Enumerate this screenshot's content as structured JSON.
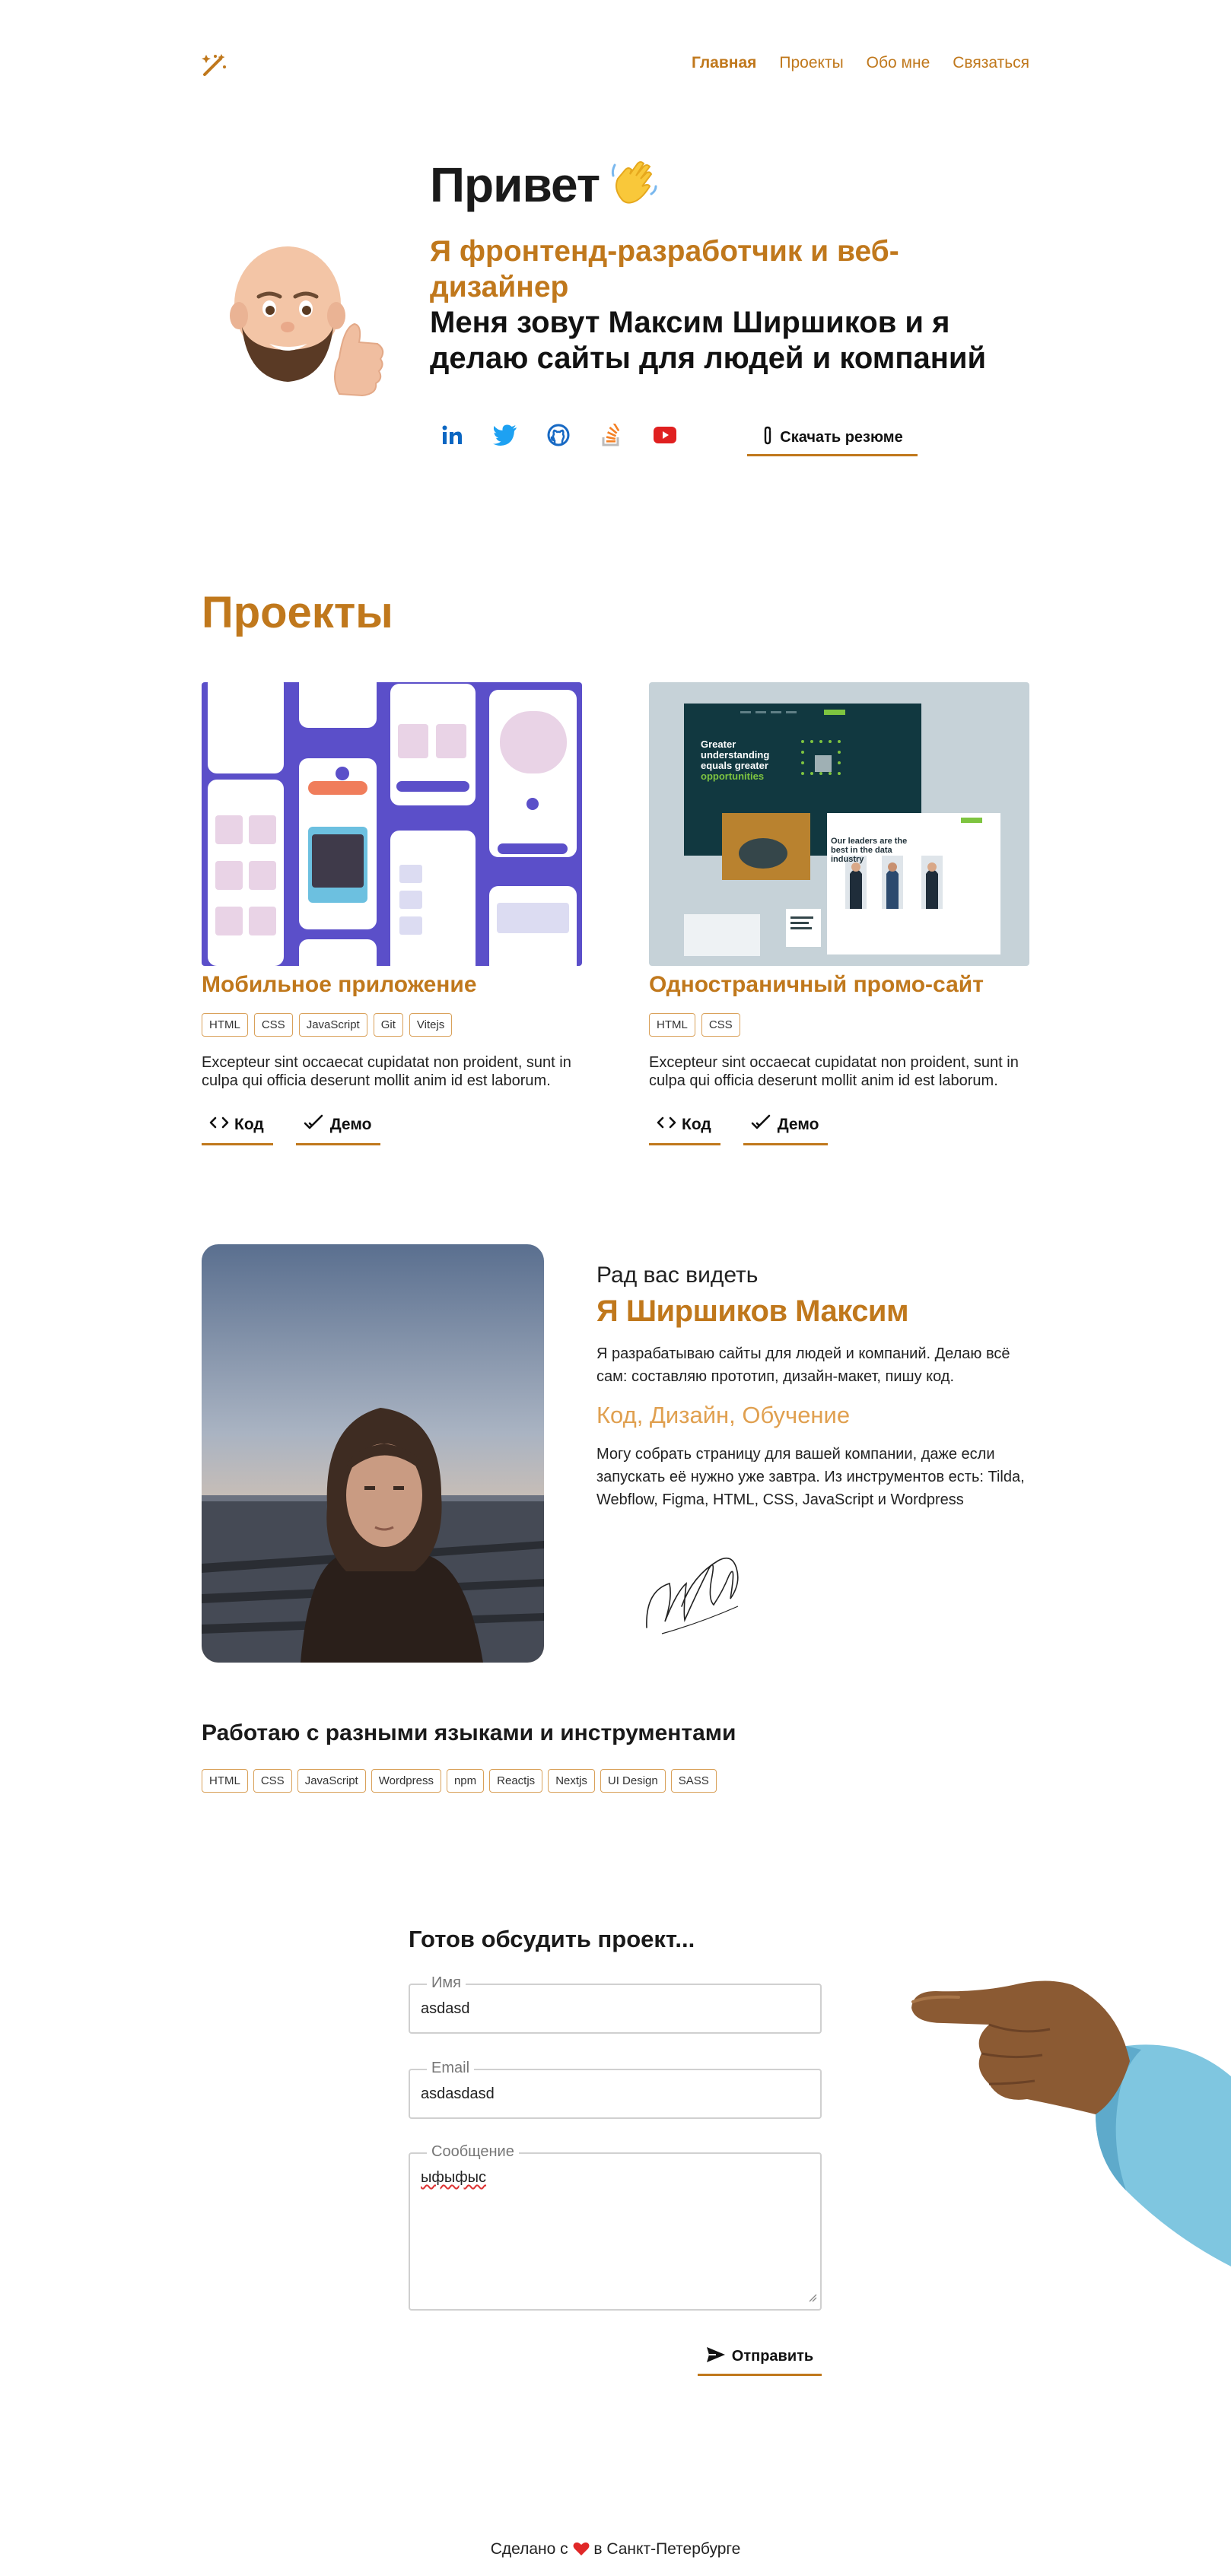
{
  "header": {
    "logo_icon": "magic-wand-icon",
    "nav": [
      {
        "label": "Главная",
        "active": true
      },
      {
        "label": "Проекты",
        "active": false
      },
      {
        "label": "Обо мне",
        "active": false
      },
      {
        "label": "Связаться",
        "active": false
      }
    ]
  },
  "hero": {
    "title": "Привет",
    "wave_icon": "waving-hand-icon",
    "subtitle": "Я фронтенд-разработчик и веб-дизайнер",
    "intro": "Меня зовут Максим Ширшиков и я делаю сайты для людей и компаний",
    "socials": [
      "linkedin-icon",
      "twitter-icon",
      "github-icon",
      "stackoverflow-icon",
      "youtube-icon"
    ],
    "resume_button": "Скачать резюме"
  },
  "projects": {
    "title": "Проекты",
    "items": [
      {
        "title": "Мобильное приложение",
        "tags": [
          "HTML",
          "CSS",
          "JavaScript",
          "Git",
          "Vitejs"
        ],
        "description": "Excepteur sint occaecat cupidatat non proident, sunt in culpa qui officia deserunt mollit anim id est laborum.",
        "code_label": "Код",
        "demo_label": "Демо"
      },
      {
        "title": "Одностраничный промо-сайт",
        "tags": [
          "HTML",
          "CSS"
        ],
        "description": "Excepteur sint occaecat cupidatat non proident, sunt in culpa qui officia deserunt mollit anim id est laborum.",
        "code_label": "Код",
        "demo_label": "Демо",
        "preview_texts": {
          "hero": "Greater understanding equals greater",
          "hero_accent": "opportunities",
          "leaders": "Our leaders are the best in the data industry"
        }
      }
    ]
  },
  "about": {
    "greeting": "Рад вас видеть",
    "name": "Я Ширшиков Максим",
    "paragraph1": "Я разрабатываю сайты для людей и компаний. Делаю всё сам: составляю прототип, дизайн-макет, пишу код.",
    "skills": "Код, Дизайн, Обучение",
    "paragraph2": "Могу собрать страницу для вашей компании, даже если запускать её нужно уже завтра. Из инструментов есть: Tilda, Webflow, Figma, HTML, CSS, JavaScript и Wordpress"
  },
  "tools": {
    "title": "Работаю с разными языками и инструментами",
    "items": [
      "HTML",
      "CSS",
      "JavaScript",
      "Wordpress",
      "npm",
      "Reactjs",
      "Nextjs",
      "UI Design",
      "SASS"
    ]
  },
  "contact": {
    "title": "Готов обсудить проект...",
    "name_label": "Имя",
    "name_value": "asdasd",
    "email_label": "Email",
    "email_value": "asdasdasd",
    "message_label": "Сообщение",
    "message_value": "ыфыфыс",
    "send_button": "Отправить"
  },
  "footer": {
    "before": "Сделано с",
    "heart_icon": "heart-icon",
    "after": "в Санкт-Петербурге"
  }
}
